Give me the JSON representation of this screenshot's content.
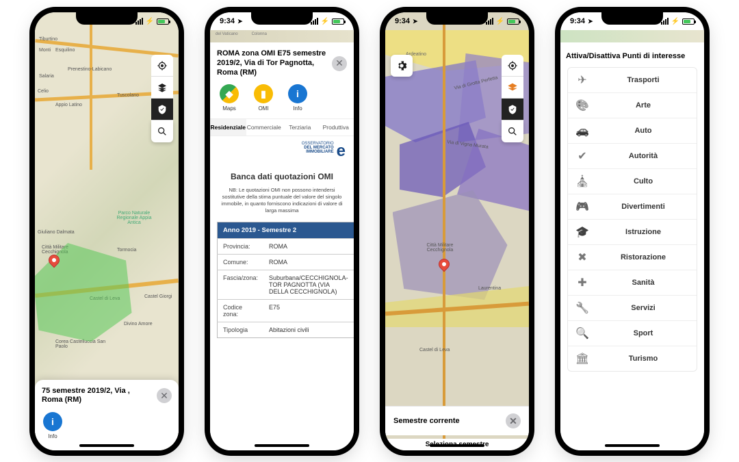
{
  "statusbar": {
    "time": "9:34"
  },
  "screen1": {
    "labels": [
      "Tiburtino",
      "Monti",
      "Esquilino",
      "Salaria",
      "Prenestino-Labicano",
      "Celio",
      "Appio Latino",
      "Tuscolano",
      "Parco Naturale Regionale Appia Antica",
      "Giuliano Dalmata",
      "Tormocia",
      "Castel di Leva",
      "Castel Giorgi",
      "Divino Amore",
      "Corea Castelluccia San Paolo",
      "Città Militare Cecchignola"
    ],
    "sheet_title": "75 semestre 2019/2, Via , Roma (RM)",
    "actions": {
      "info": "Info"
    },
    "controls": {
      "locate": "Locate",
      "layers": "Layers",
      "check": "Check",
      "search": "Search"
    }
  },
  "screen2": {
    "title": "ROMA zona OMI E75 semestre 2019/2, Via di Tor Pagnotta, Roma (RM)",
    "actions": {
      "maps": "Maps",
      "omi": "OMI",
      "info": "Info"
    },
    "tabs": [
      "Residenziale",
      "Commerciale",
      "Terziaria",
      "Produttiva"
    ],
    "logo_lines": [
      "OSSERVATORIO",
      "DEL MERCATO",
      "IMMOBILIARE"
    ],
    "heading": "Banca dati quotazioni OMI",
    "disclaimer": "NB: Le quotazioni OMI non possono intendersi sostitutive della stima puntuale del valore del singolo immobile, in quanto forniscono indicazioni di valore di larga massima",
    "table_header": "Anno 2019 - Semestre 2",
    "rows": [
      {
        "k": "Provincia:",
        "v": "ROMA"
      },
      {
        "k": "Comune:",
        "v": "ROMA"
      },
      {
        "k": "Fascia/zona:",
        "v": "Suburbana/CECCHIGNOLA-TOR PAGNOTTA (VIA DELLA CECCHIGNOLA)"
      },
      {
        "k": "Codice zona:",
        "v": "E75"
      },
      {
        "k": "Tipologia",
        "v": "Abitazioni civili"
      }
    ]
  },
  "screen3": {
    "labels": [
      "Ardeatino",
      "Via di Grotta Perfetta",
      "Via di Vigna Murata",
      "Città Militare Cecchignola",
      "Laurentina",
      "Castel di Leva"
    ],
    "selector": "Semestre corrente",
    "below": "Seleziona semestre"
  },
  "screen4": {
    "title": "Attiva/Disattiva Punti di interesse",
    "items": [
      {
        "icon": "plane",
        "label": "Trasporti"
      },
      {
        "icon": "palette",
        "label": "Arte"
      },
      {
        "icon": "car",
        "label": "Auto"
      },
      {
        "icon": "shield",
        "label": "Autorità"
      },
      {
        "icon": "church",
        "label": "Culto"
      },
      {
        "icon": "game",
        "label": "Divertimenti"
      },
      {
        "icon": "grad",
        "label": "Istruzione"
      },
      {
        "icon": "food",
        "label": "Ristorazione"
      },
      {
        "icon": "health",
        "label": "Sanità"
      },
      {
        "icon": "wrench",
        "label": "Servizi"
      },
      {
        "icon": "sport",
        "label": "Sport"
      },
      {
        "icon": "museum",
        "label": "Turismo"
      }
    ]
  }
}
